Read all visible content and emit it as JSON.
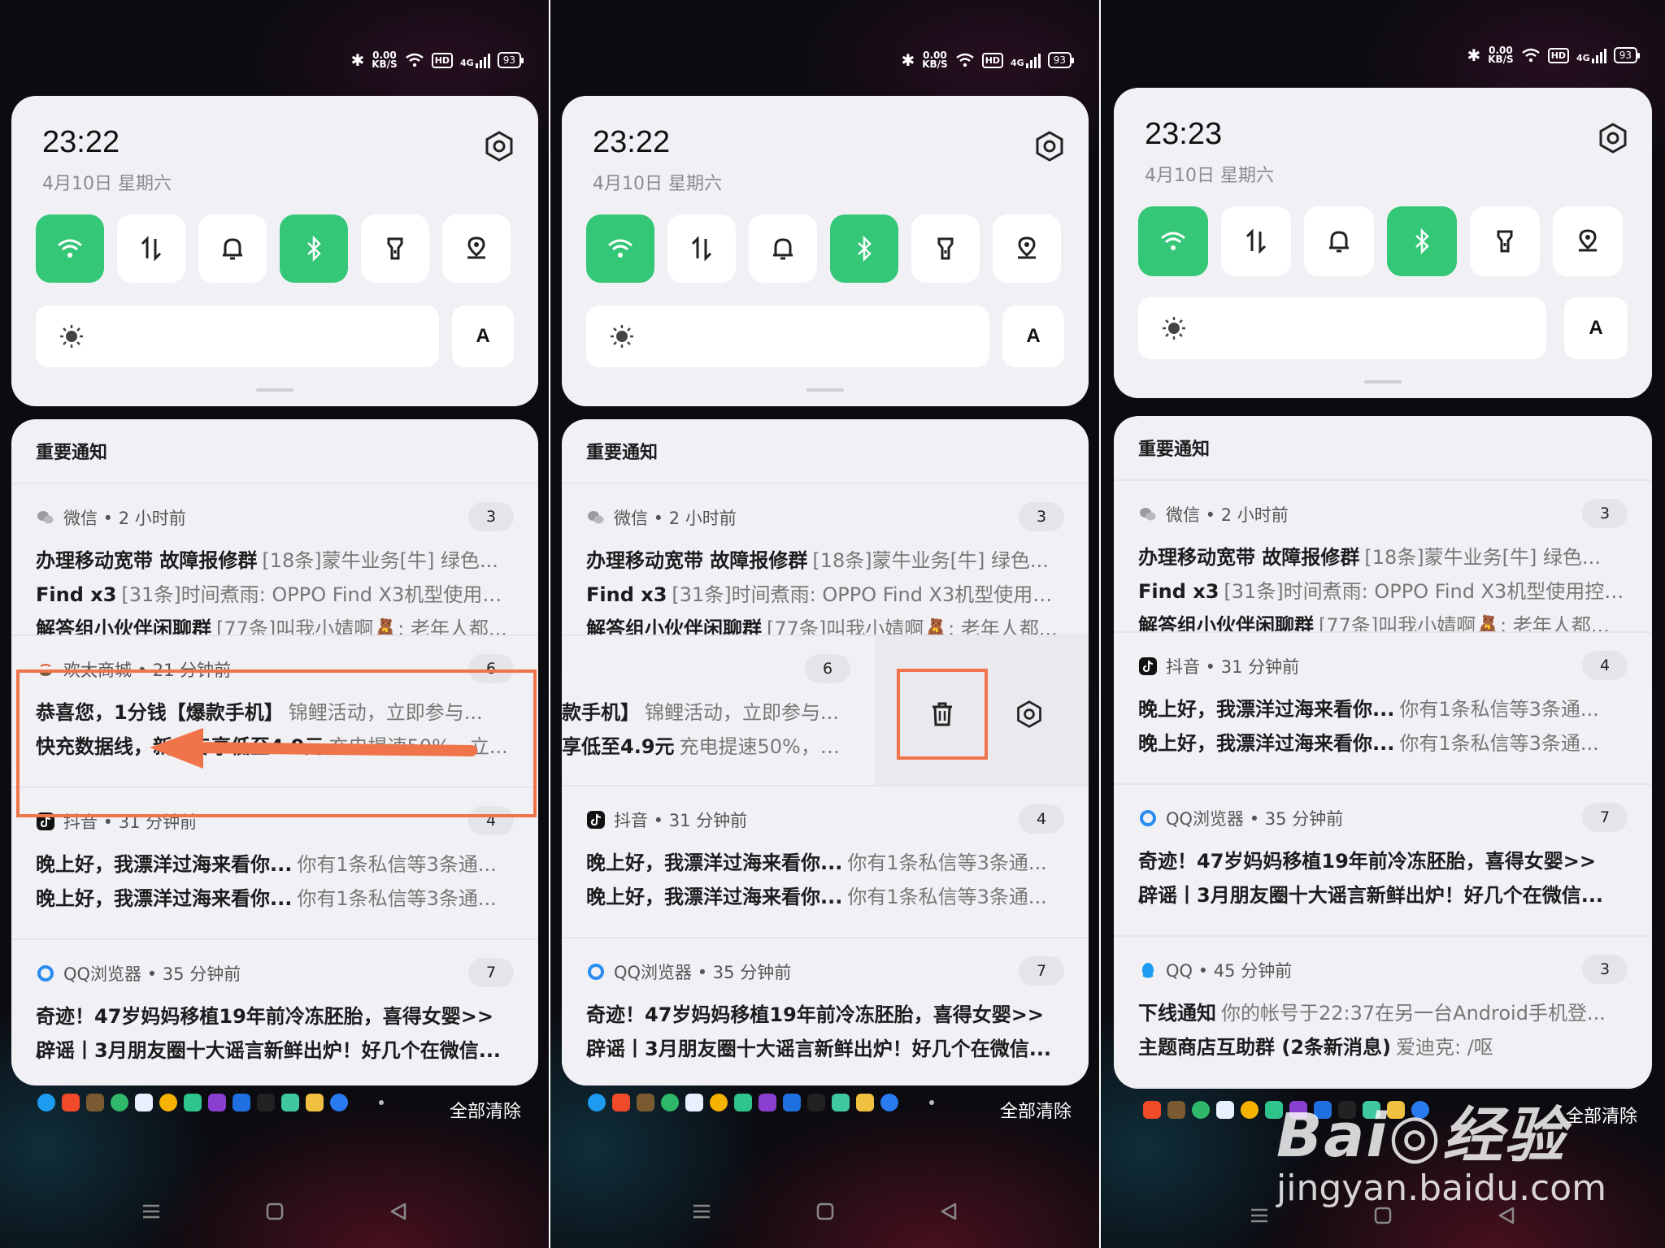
{
  "status_bar": {
    "speed": "0.00",
    "speed_unit": "KB/S",
    "hd": "HD",
    "network": "4G",
    "battery": "93"
  },
  "panels": [
    {
      "time": "23:22",
      "date": "4月10日  星期六",
      "auto_brightness": "A",
      "notifications_header": "重要通知",
      "clear_all": "全部清除"
    },
    {
      "time": "23:22",
      "date": "4月10日  星期六",
      "auto_brightness": "A",
      "notifications_header": "重要通知",
      "clear_all": "全部清除"
    },
    {
      "time": "23:23",
      "date": "4月10日  星期六",
      "auto_brightness": "A",
      "notifications_header": "重要通知",
      "clear_all": "全部清除"
    }
  ],
  "notifications": {
    "wechat": {
      "app": "微信 • 2 小时前",
      "count": "3",
      "lines": [
        {
          "title": "办理移动宽带  故障报修群",
          "text": "[18条]蒙牛业务[牛] 绿色..."
        },
        {
          "title": "Find x3",
          "text": "[31条]时间煮雨: OPPO Find X3机型使用控制..."
        },
        {
          "title": "解答组小伙伴闲聊群",
          "text": "[77条]叫我小婧啊🧸: 老年人都..."
        }
      ]
    },
    "huantai": {
      "app": "欢太商城 • 21 分钟前",
      "count": "6",
      "lines": [
        {
          "title": "恭喜您，1分钱【爆款手机】",
          "text": "锦鲤活动，立即参与..."
        },
        {
          "title": "快充数据线，新人专享低至4.9元",
          "text": "充电提速50%，立..."
        }
      ],
      "swiped_lines": [
        {
          "title": "款手机】",
          "text": "锦鲤活动，立即参与..."
        },
        {
          "title": "享低至4.9元",
          "text": "充电提速50%，立..."
        }
      ]
    },
    "douyin": {
      "app": "抖音 • 31 分钟前",
      "count": "4",
      "lines": [
        {
          "title": "晚上好，我漂洋过海来看你...",
          "text": "你有1条私信等3条通..."
        },
        {
          "title": "晚上好，我漂洋过海来看你...",
          "text": "你有1条私信等3条通..."
        }
      ]
    },
    "qqbrowser": {
      "app": "QQ浏览器 • 35 分钟前",
      "count": "7",
      "lines": [
        {
          "title": "奇迹！47岁妈妈移植19年前冷冻胚胎，喜得女婴>>",
          "text": ""
        },
        {
          "title": "辟谣丨3月朋友圈十大谣言新鲜出炉！好几个在微信...",
          "text": ""
        }
      ]
    },
    "qq": {
      "app": "QQ • 45 分钟前",
      "count": "3",
      "lines": [
        {
          "title": "下线通知",
          "text": "你的帐号于22:37在另一台Android手机登..."
        },
        {
          "title": "主题商店互助群 (2条新消息)",
          "text": "爱迪克: /呕"
        }
      ]
    }
  },
  "watermark": {
    "brand": "Bai◎经验",
    "url": "jingyan.baidu.com"
  },
  "colors": {
    "accent_green": "#34c777",
    "highlight_orange": "#f0744a"
  }
}
